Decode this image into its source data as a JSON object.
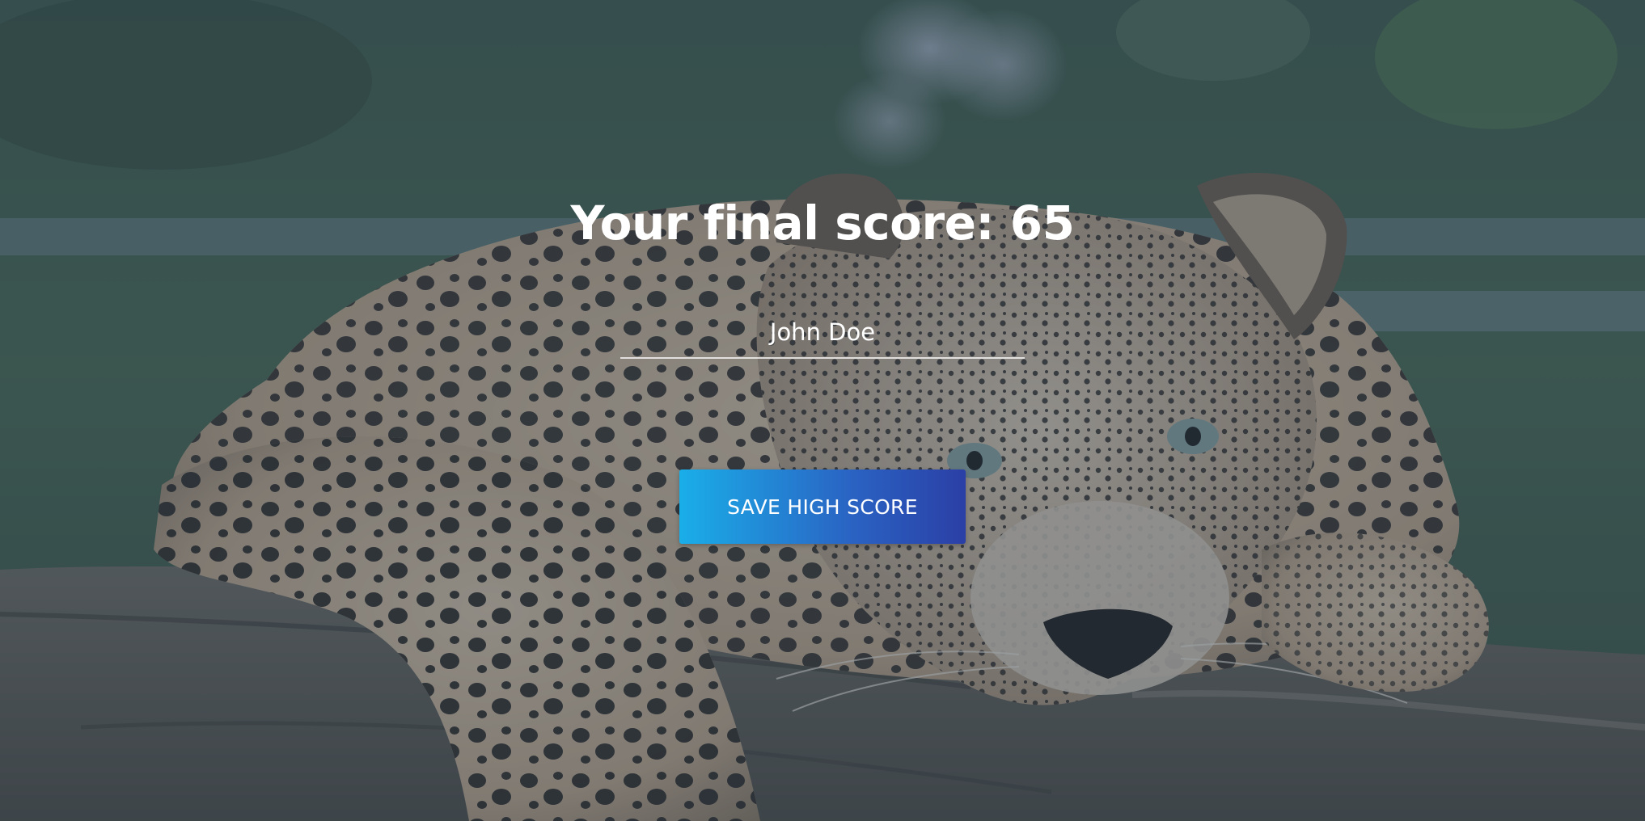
{
  "end_screen": {
    "final_score_text": "Your final score: 65",
    "username": {
      "value": "John Doe",
      "placeholder": ""
    },
    "save_button_label": "SAVE HIGH SCORE"
  },
  "background": {
    "subject": "leopard resting on a log",
    "overlay_color": "#2c3e50"
  },
  "colors": {
    "button_gradient_start": "#1aaee9",
    "button_gradient_end": "#2b3fa6",
    "text": "#ffffff"
  }
}
